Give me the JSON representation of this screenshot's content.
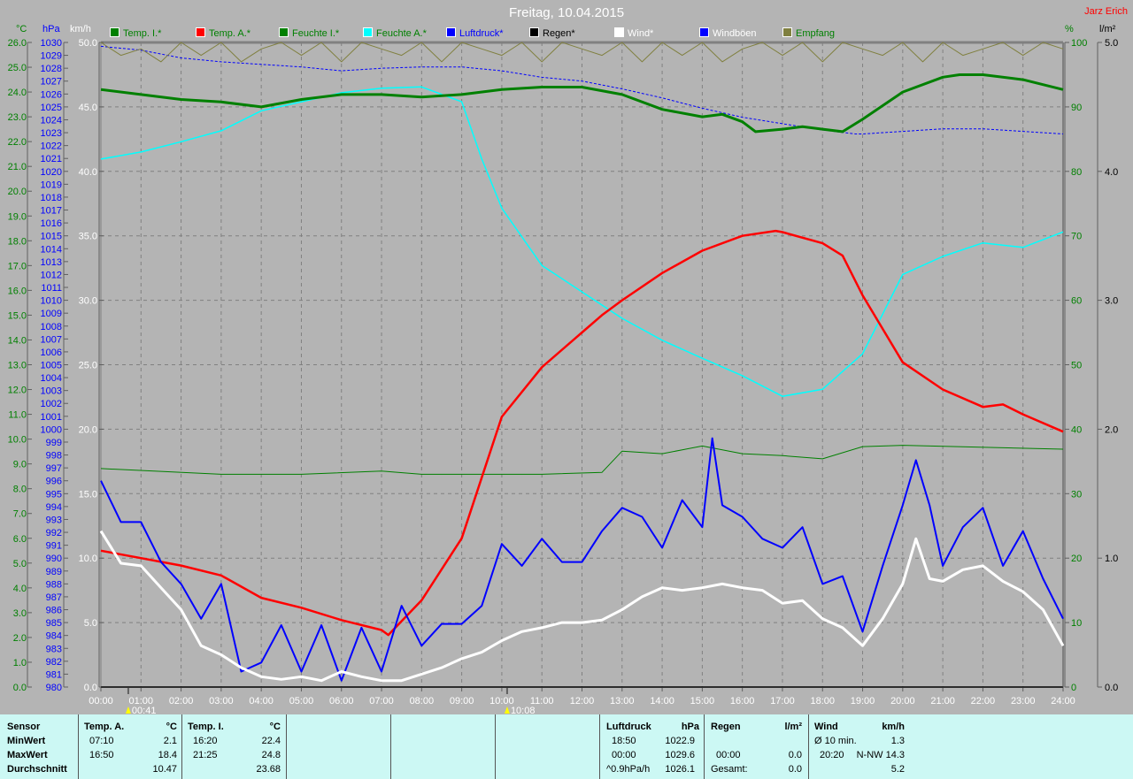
{
  "header": {
    "title": "Freitag, 10.04.2015",
    "author": "Jarz Erich"
  },
  "legend": [
    {
      "label": "Temp. I.*",
      "color": "#008000",
      "text_color": "#008000"
    },
    {
      "label": "Temp. A.*",
      "color": "#ff0000",
      "text_color": "#008000"
    },
    {
      "label": "Feuchte I.*",
      "color": "#008000",
      "text_color": "#008000"
    },
    {
      "label": "Feuchte A.*",
      "color": "#00ffff",
      "text_color": "#008000"
    },
    {
      "label": "Luftdruck*",
      "color": "#0000ff",
      "text_color": "#0000ff"
    },
    {
      "label": "Regen*",
      "color": "#000000",
      "text_color": "#000000"
    },
    {
      "label": "Wind*",
      "color": "#ffffff",
      "text_color": "#ffffff"
    },
    {
      "label": "Windböen",
      "color": "#0000ff",
      "text_color": "#ffffff"
    },
    {
      "label": "Empfang",
      "color": "#808040",
      "text_color": "#008000"
    }
  ],
  "chart_data": {
    "type": "line",
    "title": "Freitag, 10.04.2015",
    "x_unit": "hours",
    "xlim": [
      0,
      24
    ],
    "x_ticks": [
      "00:00",
      "01:00",
      "02:00",
      "03:00",
      "04:00",
      "05:00",
      "06:00",
      "07:00",
      "08:00",
      "09:00",
      "10:00",
      "11:00",
      "12:00",
      "13:00",
      "14:00",
      "15:00",
      "16:00",
      "17:00",
      "18:00",
      "19:00",
      "20:00",
      "21:00",
      "22:00",
      "23:00",
      "24:00"
    ],
    "markers": [
      {
        "x": 0.683,
        "label": "00:41"
      },
      {
        "x": 10.133,
        "label": "10:08"
      }
    ],
    "axes": {
      "temp": {
        "unit": "°C",
        "ylim": [
          0,
          26
        ],
        "step": 1.0,
        "color": "#008000"
      },
      "pressure": {
        "unit": "hPa",
        "ylim": [
          980,
          1030
        ],
        "step": 1,
        "color": "#0000ff"
      },
      "wind": {
        "unit": "km/h",
        "ylim": [
          0,
          50
        ],
        "step": 5,
        "color": "#ffffff"
      },
      "humidity": {
        "unit": "%",
        "ylim": [
          0,
          100
        ],
        "step": 10,
        "color": "#008000"
      },
      "rain": {
        "unit": "l/m²",
        "ylim": [
          0,
          5
        ],
        "step": 1,
        "color": "#000000"
      }
    },
    "grid": true,
    "series": [
      {
        "name": "Feuchte I.",
        "axis": "humidity",
        "color": "#008000",
        "width": 1,
        "x": [
          0,
          3,
          5,
          7,
          8,
          11,
          12.5,
          13,
          14,
          15,
          16,
          17,
          18,
          19,
          20,
          24
        ],
        "y": [
          33.9,
          33,
          33,
          33.5,
          33,
          33,
          33.3,
          36.6,
          36.2,
          37.4,
          36.2,
          35.9,
          35.4,
          37.3,
          37.5,
          36.9
        ]
      },
      {
        "name": "Feuchte A.",
        "axis": "humidity",
        "color": "#00ffff",
        "width": 1.5,
        "x": [
          0,
          1,
          2,
          3,
          4,
          5,
          6,
          7,
          8,
          9,
          9.5,
          10,
          11,
          12,
          13,
          14,
          15,
          16,
          17,
          18,
          19,
          20,
          21,
          22,
          23,
          24
        ],
        "y": [
          81.9,
          83,
          84.6,
          86.3,
          89.4,
          90.8,
          92.2,
          92.9,
          93.1,
          90.8,
          81.9,
          74.3,
          65.4,
          61.3,
          57.2,
          53.8,
          51,
          48.3,
          45.1,
          46.2,
          51.7,
          64,
          66.8,
          68.9,
          68.2,
          70.6
        ]
      },
      {
        "name": "Luftdruck",
        "axis": "pressure",
        "color": "#0000ff",
        "width": 1,
        "dash": "3,2",
        "x": [
          0,
          1,
          2,
          3,
          4,
          5,
          6,
          7,
          8,
          9,
          10,
          11,
          12,
          13,
          14,
          15,
          16,
          17,
          18,
          18.83,
          19,
          20,
          21,
          22,
          23,
          24
        ],
        "y": [
          1029.7,
          1029.4,
          1028.8,
          1028.5,
          1028.3,
          1028.1,
          1027.8,
          1028,
          1028.1,
          1028.1,
          1027.8,
          1027.3,
          1027,
          1026.4,
          1025.7,
          1024.9,
          1024.2,
          1023.7,
          1023.2,
          1022.9,
          1022.9,
          1023.1,
          1023.3,
          1023.3,
          1023.1,
          1022.9
        ]
      },
      {
        "name": "Temp. I.",
        "axis": "temp",
        "color": "#008000",
        "width": 3,
        "x": [
          0,
          1,
          2,
          3,
          4,
          5,
          6,
          7,
          8,
          9,
          10,
          11,
          12,
          13,
          14,
          15,
          15.5,
          16,
          16.33,
          17,
          17.5,
          18,
          18.5,
          19,
          20,
          21,
          21.42,
          22,
          23,
          24
        ],
        "y": [
          24.1,
          23.9,
          23.7,
          23.6,
          23.4,
          23.7,
          23.9,
          23.9,
          23.8,
          23.9,
          24.1,
          24.2,
          24.2,
          23.9,
          23.3,
          23,
          23.1,
          22.8,
          22.4,
          22.5,
          22.6,
          22.5,
          22.4,
          22.9,
          24,
          24.6,
          24.7,
          24.7,
          24.5,
          24.1
        ]
      },
      {
        "name": "Temp. A.",
        "axis": "temp",
        "color": "#ff0000",
        "width": 2.5,
        "x": [
          0,
          1,
          2,
          3,
          4,
          5,
          6,
          7,
          7.17,
          8,
          9,
          10,
          11,
          12,
          12.5,
          13,
          14,
          15,
          16,
          16.83,
          17,
          18,
          18.5,
          19,
          20,
          21,
          22,
          22.5,
          23,
          24
        ],
        "y": [
          5.5,
          5.2,
          4.9,
          4.5,
          3.6,
          3.2,
          2.7,
          2.3,
          2.1,
          3.5,
          6,
          10.9,
          12.9,
          14.3,
          15,
          15.6,
          16.7,
          17.6,
          18.2,
          18.4,
          18.35,
          17.9,
          17.4,
          15.8,
          13.1,
          12,
          11.3,
          11.4,
          11,
          10.3
        ]
      },
      {
        "name": "Windböen",
        "axis": "wind",
        "color": "#0000ff",
        "width": 2,
        "x": [
          0,
          0.5,
          1,
          1.5,
          2,
          2.5,
          3,
          3.5,
          4,
          4.5,
          5,
          5.5,
          6,
          6.5,
          7,
          7.5,
          8,
          8.5,
          9,
          9.5,
          10,
          10.5,
          11,
          11.5,
          12,
          12.5,
          13,
          13.5,
          14,
          14.5,
          15,
          15.25,
          15.5,
          16,
          16.5,
          17,
          17.5,
          18,
          18.5,
          19,
          19.5,
          20,
          20.33,
          20.67,
          21,
          21.5,
          22,
          22.5,
          23,
          23.5,
          24
        ],
        "y": [
          16,
          12.8,
          12.8,
          9.7,
          8,
          5.3,
          8,
          1.2,
          1.9,
          4.8,
          1.2,
          4.8,
          0.5,
          4.6,
          1.2,
          6.3,
          3.2,
          4.9,
          4.9,
          6.3,
          11.1,
          9.4,
          11.5,
          9.7,
          9.7,
          12.1,
          13.9,
          13.2,
          10.8,
          14.5,
          12.4,
          19.3,
          14.1,
          13.2,
          11.5,
          10.8,
          12.4,
          8,
          8.6,
          4.3,
          9.4,
          14.1,
          17.6,
          14.1,
          9.4,
          12.4,
          13.9,
          9.4,
          12.1,
          8.4,
          5.3
        ]
      },
      {
        "name": "Wind",
        "axis": "wind",
        "color": "#ffffff",
        "width": 3,
        "x": [
          0,
          0.5,
          1,
          1.5,
          2,
          2.5,
          3,
          3.5,
          4,
          4.5,
          5,
          5.5,
          6,
          6.5,
          7,
          7.5,
          8,
          8.5,
          9,
          9.5,
          10,
          10.5,
          11,
          11.5,
          12,
          12.5,
          13,
          13.5,
          14,
          14.5,
          15,
          15.5,
          16,
          16.5,
          17,
          17.5,
          18,
          18.5,
          19,
          19.5,
          20,
          20.33,
          20.67,
          21,
          21.5,
          22,
          22.5,
          23,
          23.5,
          24
        ],
        "y": [
          12.1,
          9.6,
          9.4,
          7.7,
          6,
          3.2,
          2.5,
          1.5,
          0.8,
          0.6,
          0.8,
          0.5,
          1.2,
          0.8,
          0.5,
          0.5,
          1.0,
          1.5,
          2.2,
          2.7,
          3.6,
          4.3,
          4.6,
          5,
          5,
          5.2,
          6,
          7,
          7.7,
          7.5,
          7.7,
          8,
          7.7,
          7.5,
          6.5,
          6.7,
          5.3,
          4.6,
          3.2,
          5.3,
          8,
          11.5,
          8.4,
          8.2,
          9.1,
          9.4,
          8.2,
          7.4,
          6,
          3.2
        ]
      },
      {
        "name": "Empfang",
        "axis": "humidity",
        "color": "#808040",
        "width": 1,
        "x": [
          0,
          0.5,
          1,
          1.5,
          2,
          2.5,
          3,
          3.5,
          4,
          4.5,
          5,
          5.5,
          6,
          6.5,
          7,
          7.5,
          8,
          8.5,
          9,
          9.5,
          10,
          10.5,
          11,
          11.5,
          12,
          12.5,
          13,
          13.5,
          14,
          14.5,
          15,
          15.5,
          16,
          16.5,
          17,
          17.5,
          18,
          18.5,
          19,
          19.5,
          20,
          20.5,
          21,
          21.5,
          22,
          22.5,
          23,
          23.5,
          24
        ],
        "y": [
          100,
          98,
          99,
          97,
          100,
          98,
          100,
          97,
          99,
          100,
          98,
          100,
          97,
          100,
          99,
          98,
          100,
          97,
          100,
          99,
          98,
          100,
          97,
          100,
          99,
          98,
          100,
          97,
          100,
          98,
          100,
          97,
          99,
          100,
          98,
          100,
          97,
          100,
          99,
          98,
          100,
          97,
          100,
          98,
          99,
          100,
          98,
          100,
          99
        ]
      },
      {
        "name": "Regen",
        "axis": "rain",
        "color": "#000000",
        "width": 1,
        "x": [
          0,
          24
        ],
        "y": [
          0,
          0
        ]
      }
    ]
  },
  "stats": {
    "labels": {
      "sensor": "Sensor",
      "min": "MinWert",
      "max": "MaxWert",
      "avg": "Durchschnitt"
    },
    "temp_a": {
      "title": "Temp. A.",
      "unit": "°C",
      "min_time": "07:10",
      "min": "2.1",
      "max_time": "16:50",
      "max": "18.4",
      "avg": "10.47"
    },
    "temp_i": {
      "title": "Temp. I.",
      "unit": "°C",
      "min_time": "16:20",
      "min": "22.4",
      "max_time": "21:25",
      "max": "24.8",
      "avg": "23.68"
    },
    "pressure": {
      "title": "Luftdruck",
      "unit": "hPa",
      "min_time": "18:50",
      "min": "1022.9",
      "max_time": "00:00",
      "max": "1029.6",
      "trend": "^0.9hPa/h",
      "avg": "1026.1"
    },
    "rain": {
      "title": "Regen",
      "unit": "l/m²",
      "max_time": "00:00",
      "max": "0.0",
      "total_label": "Gesamt:",
      "total": "0.0"
    },
    "wind": {
      "title": "Wind",
      "unit": "km/h",
      "avg10_label": "Ø 10 min.",
      "avg10": "1.3",
      "max_time": "20:20",
      "max": "N-NW 14.3",
      "avg": "5.2"
    }
  }
}
